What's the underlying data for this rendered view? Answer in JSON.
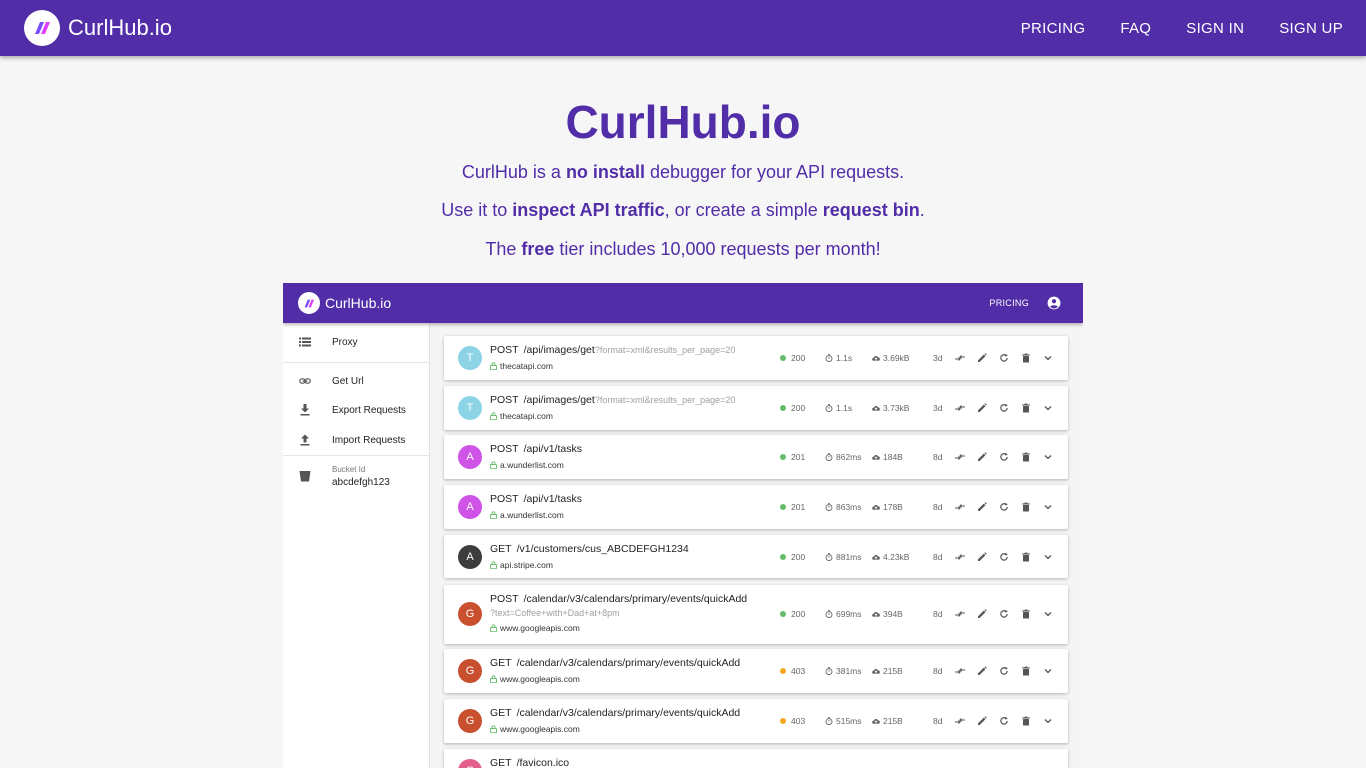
{
  "topbar": {
    "brand": "CurlHub.io",
    "nav": [
      "PRICING",
      "FAQ",
      "SIGN IN",
      "SIGN UP"
    ]
  },
  "hero": {
    "title": "CurlHub.io",
    "line1": [
      "CurlHub is a ",
      "no install",
      " debugger for your API requests."
    ],
    "line2": [
      "Use it to ",
      "inspect API traffic",
      ", or create a simple ",
      "request bin",
      "."
    ],
    "line3": [
      "The ",
      "free",
      " tier includes 10,000 requests per month!"
    ]
  },
  "demo": {
    "brand": "CurlHub.io",
    "pricing": "PRICING",
    "sidebar": {
      "proxy": "Proxy",
      "get_url": "Get Url",
      "export": "Export Requests",
      "import": "Import Requests",
      "bucket_label": "Bucket Id",
      "bucket_id": "abcdefgh123"
    },
    "requests": [
      {
        "letter": "T",
        "color": "#8dd3e6",
        "method": "POST",
        "path": "/api/images/get",
        "query": "?format=xml&results_per_page=20",
        "host": "thecatapi.com",
        "status": "200",
        "status_color": "#66bb6a",
        "time": "1.1s",
        "size": "3.69kB",
        "age": "3d"
      },
      {
        "letter": "T",
        "color": "#8dd3e6",
        "method": "POST",
        "path": "/api/images/get",
        "query": "?format=xml&results_per_page=20",
        "host": "thecatapi.com",
        "status": "200",
        "status_color": "#66bb6a",
        "time": "1.1s",
        "size": "3.73kB",
        "age": "3d"
      },
      {
        "letter": "A",
        "color": "#cf53e6",
        "method": "POST",
        "path": "/api/v1/tasks",
        "query": "",
        "host": "a.wunderlist.com",
        "status": "201",
        "status_color": "#66bb6a",
        "time": "862ms",
        "size": "184B",
        "age": "8d"
      },
      {
        "letter": "A",
        "color": "#cf53e6",
        "method": "POST",
        "path": "/api/v1/tasks",
        "query": "",
        "host": "a.wunderlist.com",
        "status": "201",
        "status_color": "#66bb6a",
        "time": "863ms",
        "size": "178B",
        "age": "8d"
      },
      {
        "letter": "A",
        "color": "#3d3d3d",
        "method": "GET",
        "path": "/v1/customers/cus_ABCDEFGH1234",
        "query": "",
        "host": "api.stripe.com",
        "status": "200",
        "status_color": "#66bb6a",
        "time": "881ms",
        "size": "4.23kB",
        "age": "8d"
      },
      {
        "letter": "G",
        "color": "#c9502e",
        "method": "POST",
        "path": "/calendar/v3/calendars/primary/events/quickAdd",
        "query": "",
        "query_line": "?text=Coffee+with+Dad+at+8pm",
        "host": "www.googleapis.com",
        "status": "200",
        "status_color": "#66bb6a",
        "time": "699ms",
        "size": "394B",
        "age": "8d"
      },
      {
        "letter": "G",
        "color": "#c9502e",
        "method": "GET",
        "path": "/calendar/v3/calendars/primary/events/quickAdd",
        "query": "",
        "host": "www.googleapis.com",
        "status": "403",
        "status_color": "#f5a623",
        "time": "381ms",
        "size": "215B",
        "age": "8d"
      },
      {
        "letter": "G",
        "color": "#c9502e",
        "method": "GET",
        "path": "/calendar/v3/calendars/primary/events/quickAdd",
        "query": "",
        "host": "www.googleapis.com",
        "status": "403",
        "status_color": "#f5a623",
        "time": "515ms",
        "size": "215B",
        "age": "8d"
      },
      {
        "letter": "G",
        "color": "#e25e8c",
        "method": "GET",
        "path": "/favicon.ico",
        "query": "",
        "host": "",
        "status": "",
        "status_color": "#f5a623",
        "time": "",
        "size": "",
        "age": ""
      }
    ]
  },
  "colors": {
    "brand": "#512da8",
    "success": "#66bb6a",
    "warning": "#f5a623"
  }
}
